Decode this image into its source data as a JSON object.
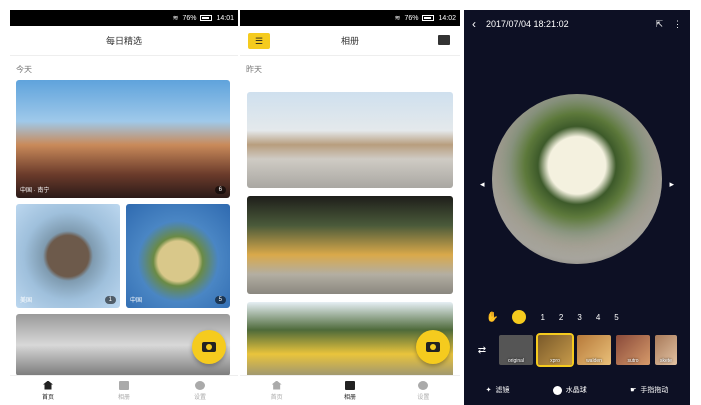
{
  "panel1": {
    "status": {
      "wifi": "⌔",
      "signal": "◢",
      "battery_pct": "76%",
      "time": "14:01"
    },
    "title": "每日精选",
    "section": "今天",
    "photos": [
      {
        "location": "中国 · 南宁",
        "count": "6"
      },
      {
        "location": "美国",
        "count": "1"
      },
      {
        "location": "中国",
        "count": "5"
      }
    ],
    "nav": [
      "首页",
      "相册",
      "设置"
    ]
  },
  "panel2": {
    "status": {
      "battery_pct": "76%",
      "time": "14:02"
    },
    "title": "相册",
    "section": "昨天",
    "nav": [
      "首页",
      "相册",
      "设置"
    ]
  },
  "panel3": {
    "datetime": "2017/07/04 18:21:02",
    "numbers": [
      "1",
      "2",
      "3",
      "4",
      "5"
    ],
    "filters": [
      "original",
      "xpro",
      "walden",
      "sutro",
      "skete"
    ],
    "tools": [
      "滤镜",
      "水晶球",
      "手指拖动"
    ]
  },
  "colors": {
    "accent": "#f5cb1e",
    "dark_bg": "#0d1024"
  }
}
